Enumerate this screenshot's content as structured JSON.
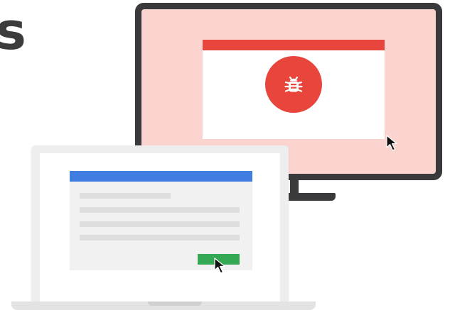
{
  "heading_fragment": "s",
  "colors": {
    "monitor_frame": "#3a3a3c",
    "monitor_screen": "#fbd4d0",
    "error_red": "#e8453c",
    "laptop_frame": "#eeeeee",
    "laptop_window": "#f1f1f2",
    "window_bar_blue": "#3f7de0",
    "text_line_gray": "#dedede",
    "button_green": "#34a853"
  },
  "monitor": {
    "window": {
      "titlebar_icon": "none"
    },
    "badge_icon": "bug-icon",
    "cursor_icon": "mouse-pointer-icon"
  },
  "laptop": {
    "window": {
      "placeholder_lines": 4
    },
    "button_icon": "none",
    "cursor_icon": "mouse-pointer-icon"
  }
}
